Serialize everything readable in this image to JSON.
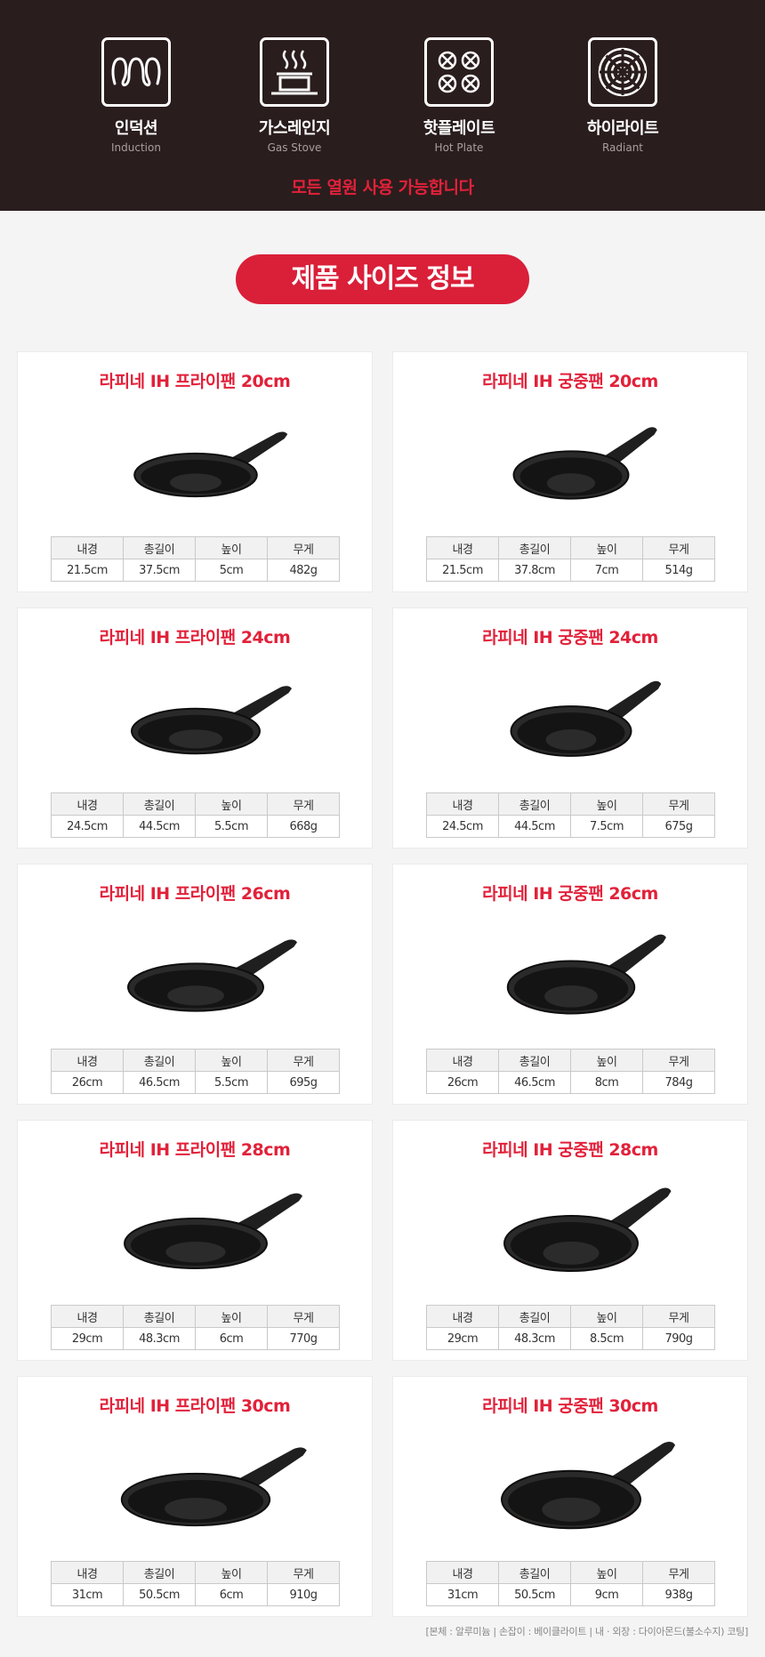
{
  "heat_sources": [
    {
      "ko": "인덕션",
      "en": "Induction",
      "icon": "induction-icon"
    },
    {
      "ko": "가스레인지",
      "en": "Gas Stove",
      "icon": "gas-stove-icon"
    },
    {
      "ko": "핫플레이트",
      "en": "Hot Plate",
      "icon": "hot-plate-icon"
    },
    {
      "ko": "하이라이트",
      "en": "Radiant",
      "icon": "radiant-icon"
    }
  ],
  "notice": "모든 열원 사용 가능합니다",
  "section_title": "제품 사이즈 정보",
  "spec_headers": [
    "내경",
    "총길이",
    "높이",
    "무게"
  ],
  "products": [
    {
      "title": "라피네 IH 프라이팬 20cm",
      "type": "frypan",
      "scale": 0.86,
      "specs": [
        "21.5cm",
        "37.5cm",
        "5cm",
        "482g"
      ]
    },
    {
      "title": "라피네 IH 궁중팬 20cm",
      "type": "wok",
      "scale": 0.86,
      "specs": [
        "21.5cm",
        "37.8cm",
        "7cm",
        "514g"
      ]
    },
    {
      "title": "라피네 IH 프라이팬 24cm",
      "type": "frypan",
      "scale": 0.9,
      "specs": [
        "24.5cm",
        "44.5cm",
        "5.5cm",
        "668g"
      ]
    },
    {
      "title": "라피네 IH 궁중팬 24cm",
      "type": "wok",
      "scale": 0.9,
      "specs": [
        "24.5cm",
        "44.5cm",
        "7.5cm",
        "675g"
      ]
    },
    {
      "title": "라피네 IH 프라이팬 26cm",
      "type": "frypan",
      "scale": 0.95,
      "specs": [
        "26cm",
        "46.5cm",
        "5.5cm",
        "695g"
      ]
    },
    {
      "title": "라피네 IH 궁중팬 26cm",
      "type": "wok",
      "scale": 0.95,
      "specs": [
        "26cm",
        "46.5cm",
        "8cm",
        "784g"
      ]
    },
    {
      "title": "라피네 IH 프라이팬 28cm",
      "type": "frypan",
      "scale": 1.0,
      "specs": [
        "29cm",
        "48.3cm",
        "6cm",
        "770g"
      ]
    },
    {
      "title": "라피네 IH 궁중팬 28cm",
      "type": "wok",
      "scale": 1.0,
      "specs": [
        "29cm",
        "48.3cm",
        "8.5cm",
        "790g"
      ]
    },
    {
      "title": "라피네 IH 프라이팬 30cm",
      "type": "frypan",
      "scale": 1.04,
      "specs": [
        "31cm",
        "50.5cm",
        "6cm",
        "910g"
      ]
    },
    {
      "title": "라피네 IH 궁중팬 30cm",
      "type": "wok",
      "scale": 1.04,
      "specs": [
        "31cm",
        "50.5cm",
        "9cm",
        "938g"
      ]
    }
  ],
  "footnote": "[본체 : 알루미늄 | 손잡이 : 베이클라이트 | 내 · 외장 : 다이아몬드(불소수지) 코팅]",
  "colors": {
    "header_bg": "#2a1d1d",
    "accent": "#e2213a",
    "pan_body": "#c94a48",
    "pan_coating": "#141414",
    "handle": "#1f1f1f"
  }
}
